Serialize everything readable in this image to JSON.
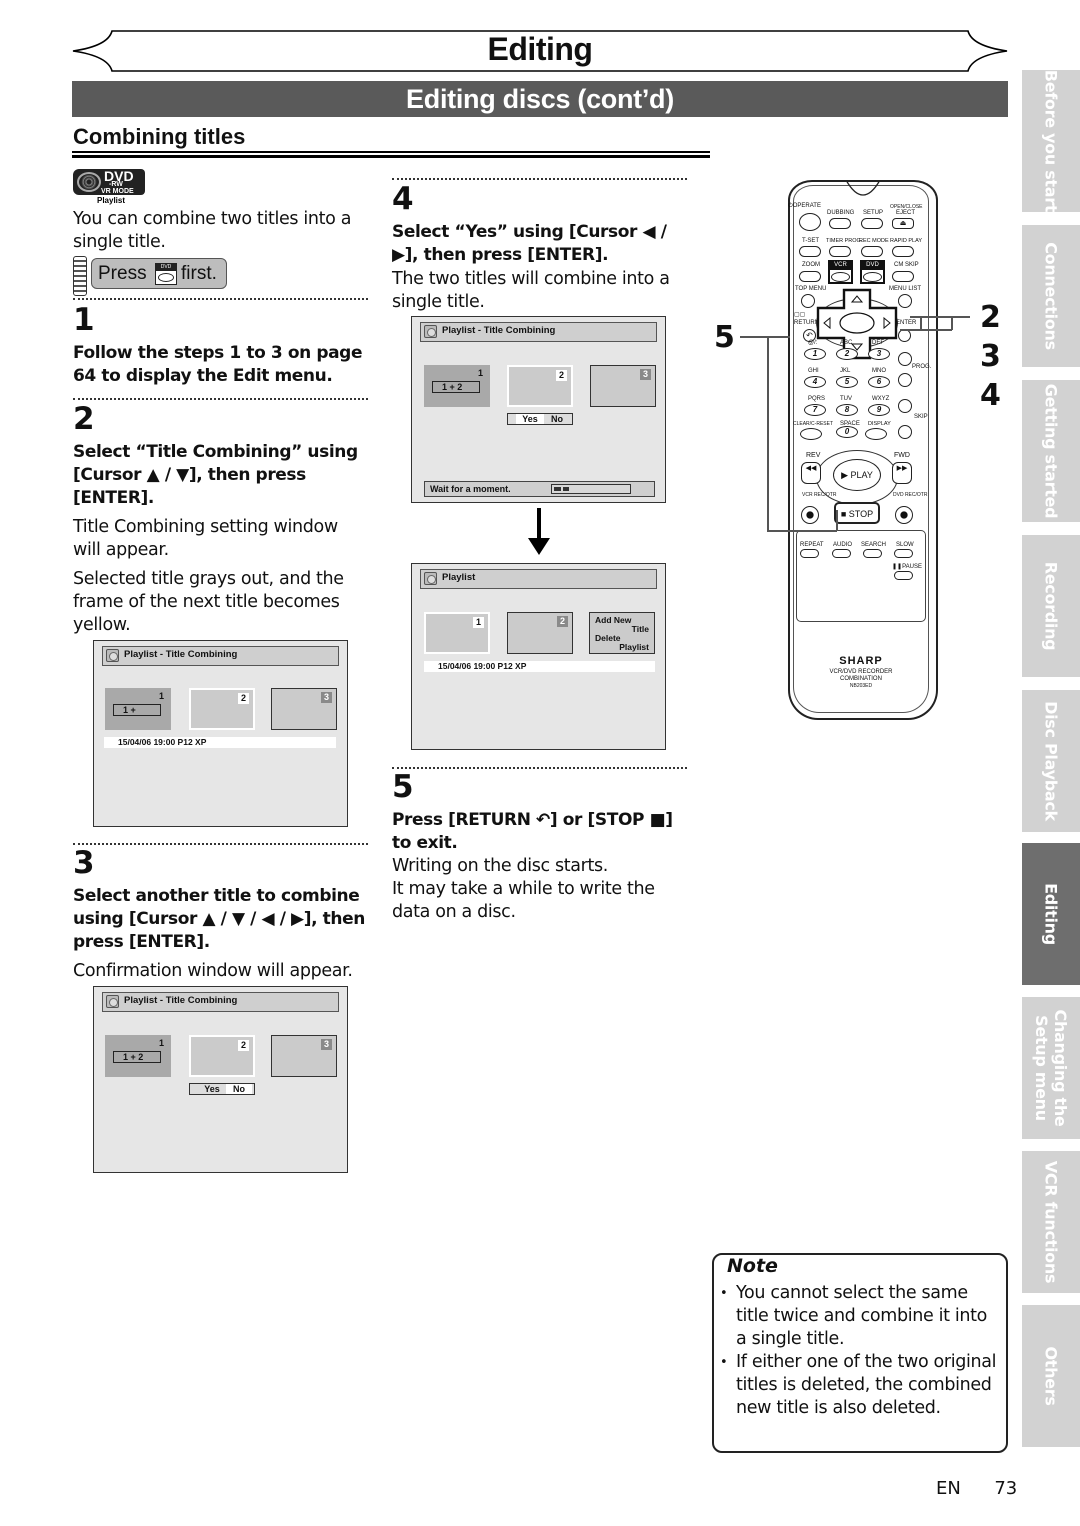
{
  "header": {
    "chapter_title": "Editing",
    "section_title": "Editing discs (cont’d)",
    "subsection_title": "Combining titles"
  },
  "badge": {
    "disc_type": "DVD",
    "format_line1": "-RW",
    "format_line2": "VR MODE",
    "mode": "Playlist"
  },
  "intro_text": "You can combine two titles into a single title.",
  "press_first": {
    "prefix": "Press",
    "key": "DVD",
    "suffix": "first."
  },
  "steps": [
    {
      "number": "1",
      "instruction": "Follow the steps 1 to 3 on page 64 to display the Edit menu.",
      "notes": []
    },
    {
      "number": "2",
      "instruction": "Select “Title Combining” using [Cursor ▲ / ▼], then press [ENTER].",
      "notes": [
        "Title Combining setting window will appear.",
        "Selected title grays out, and the frame of the next title becomes yellow."
      ]
    },
    {
      "number": "3",
      "instruction": "Select another title to combine using [Cursor ▲ / ▼ / ◀ / ▶], then press [ENTER].",
      "notes": [
        "Confirmation window will appear."
      ]
    },
    {
      "number": "4",
      "instruction": "Select “Yes” using [Cursor ◀ / ▶], then press [ENTER].",
      "notes": [
        "The two titles will combine into a single title."
      ]
    },
    {
      "number": "5",
      "instruction": "Press [RETURN ↶] or [STOP ■] to exit.",
      "notes": [
        "Writing on the disc starts.",
        "It may take a while to write the data on a disc."
      ]
    }
  ],
  "screens": {
    "step2": {
      "title": "Playlist - Title Combining",
      "thumbs": [
        "1",
        "2",
        "3"
      ],
      "combo": "1 +",
      "info": "15/04/06  19:00  P12  XP"
    },
    "step3": {
      "title": "Playlist - Title Combining",
      "thumbs": [
        "1",
        "2",
        "3"
      ],
      "combo": "1 + 2",
      "yes": "Yes",
      "no": "No",
      "selected": "No"
    },
    "step4": {
      "title": "Playlist - Title Combining",
      "thumbs": [
        "1",
        "2",
        "3"
      ],
      "combo": "1 + 2",
      "yes": "Yes",
      "no": "No",
      "selected": "Yes",
      "wait": "Wait for a moment.",
      "progress_fraction": 0.2
    },
    "result": {
      "title": "Playlist",
      "thumbs": [
        "1",
        "2"
      ],
      "menu_line1": "Add New",
      "menu_line2": "Title",
      "menu_line3": "Delete",
      "menu_line4": "Playlist",
      "info": "15/04/06  19:00  P12  XP"
    }
  },
  "remote": {
    "labels": {
      "operate": "⏻OPERATE",
      "dubbing": "DUBBING",
      "setup": "SETUP",
      "open_close": "OPEN/CLOSE",
      "eject": "EJECT",
      "tset": "T-SET",
      "timer_prog": "TIMER PROG.",
      "rec_mode": "REC MODE",
      "rapid_play": "RAPID PLAY",
      "zoom": "ZOOM",
      "vcr": "VCR",
      "dvd": "DVD",
      "cm_skip": "CM SKIP",
      "top_menu": "TOP MENU",
      "menu_list": "MENU LIST",
      "return": "RETURN",
      "enter": "ENTER",
      "prog": "PROG.",
      "skip": "SKIP",
      "clear": "CLEAR/C-RESET",
      "space": "SPACE",
      "display": "DISPLAY",
      "rev": "REV",
      "fwd": "FWD",
      "play": "PLAY",
      "stop": "STOP",
      "vcr_rec": "VCR REC/OTR",
      "dvd_rec": "DVD REC/OTR",
      "repeat": "REPEAT",
      "audio": "AUDIO",
      "search": "SEARCH",
      "slow": "SLOW",
      "pause": "PAUSE",
      "brand": "SHARP",
      "model_line1": "VCR/DVD RECORDER",
      "model_line2": "COMBINATION",
      "model_number": "NB203ED"
    },
    "number_keys": [
      {
        "digit": "1",
        "letters": "@/:"
      },
      {
        "digit": "2",
        "letters": "ABC"
      },
      {
        "digit": "3",
        "letters": "DEF"
      },
      {
        "digit": "4",
        "letters": "GHI"
      },
      {
        "digit": "5",
        "letters": "JKL"
      },
      {
        "digit": "6",
        "letters": "MNO"
      },
      {
        "digit": "7",
        "letters": "PQRS"
      },
      {
        "digit": "8",
        "letters": "TUV"
      },
      {
        "digit": "9",
        "letters": "WXYZ"
      },
      {
        "digit": "0",
        "letters": "SPACE"
      }
    ],
    "callouts_left": [
      "5"
    ],
    "callouts_right": [
      "2",
      "3",
      "4"
    ]
  },
  "side_tabs": [
    {
      "label": "Before you start",
      "active": false
    },
    {
      "label": "Connections",
      "active": false
    },
    {
      "label": "Getting started",
      "active": false
    },
    {
      "label": "Recording",
      "active": false
    },
    {
      "label": "Disc Playback",
      "active": false
    },
    {
      "label": "Editing",
      "active": true
    },
    {
      "label": "Changing the Setup menu",
      "active": false
    },
    {
      "label": "VCR functions",
      "active": false
    },
    {
      "label": "Others",
      "active": false
    }
  ],
  "note": {
    "title": "Note",
    "items": [
      "You cannot select the same title twice and combine it into a single title.",
      "If either one of the two original titles is deleted, the combined new title is also deleted."
    ]
  },
  "footer": {
    "language": "EN",
    "page_number": "73"
  }
}
